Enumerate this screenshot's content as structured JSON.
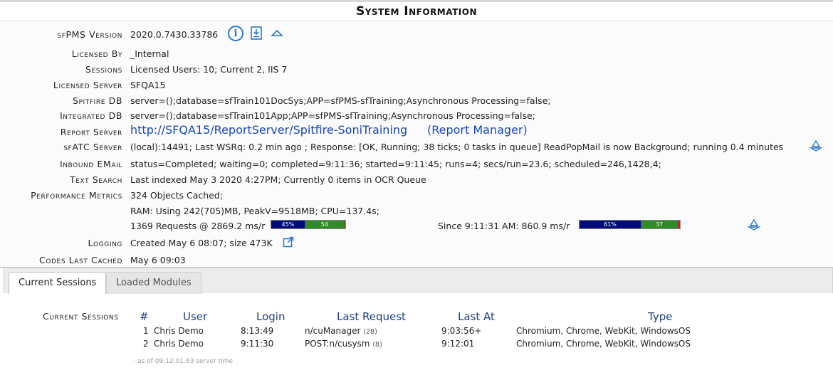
{
  "page_title": "System Information",
  "info": {
    "version_label": "sfPMS Version",
    "version_value": "2020.0.7430.33786",
    "licensed_by_label": "Licensed By",
    "licensed_by_value": "_Internal",
    "sessions_label": "Sessions",
    "sessions_value": "Licensed Users: 10; Current 2, IIS 7",
    "licensed_server_label": "Licensed Server",
    "licensed_server_value": "SFQA15",
    "spitfire_db_label": "Spitfire DB",
    "spitfire_db_value": "server=();database=sfTrain101DocSys;APP=sfPMS-sfTraining;Asynchronous Processing=false;",
    "integrated_db_label": "Integrated DB",
    "integrated_db_value": "server=();database=sfTrain101App;APP=sfPMS-sfTraining;Asynchronous Processing=false;",
    "report_server_label": "Report Server",
    "report_server_url": "http://SFQA15/ReportServer/Spitfire-SoniTraining",
    "report_manager_link": "(Report Manager)",
    "sfatc_label": "sfATC Server",
    "sfatc_value": "(local):14491; Last WSRq: 0.2 min ago ; Response: [OK, Running; 38 ticks; 0 tasks in queue] ReadPopMail is now Background; running 0.4 minutes",
    "inbound_email_label": "Inbound EMail",
    "inbound_email_value": "status=Completed; waiting=0; completed=9:11:36; started=9:11:45; runs=4; secs/run=23.6; scheduled=246,1428,4;",
    "text_search_label": "Text Search",
    "text_search_value": "Indexed May 3 2020 4:27PM; Currently 0 items in OCR Queue",
    "text_search_prefix": "Last indexed May 3 2020 4:27PM; Currently 0 items in OCR Queue",
    "perf_label": "Performance Metrics",
    "perf_cached": "324 Objects Cached;",
    "perf_ram": "RAM: Using 242(705)MB, PeakV=9518MB; CPU=137.4s;",
    "perf_requests": "1369 Requests @ 2869.2 ms/r",
    "perf_since": "Since 9:11:31 AM: 860.9 ms/r",
    "bar1": {
      "blue_pct": 45,
      "green_pct": 54,
      "blue_label": "45%",
      "green_label": "54"
    },
    "bar2": {
      "blue_pct": 61,
      "green_pct": 37,
      "blue_label": "61%",
      "green_label": "37"
    },
    "logging_label": "Logging",
    "logging_value": "Created May 6 08:07; size 473K",
    "codes_label": "Codes Last Cached",
    "codes_value": "May 6 09:03"
  },
  "tabs": [
    {
      "label": "Current Sessions",
      "active": true
    },
    {
      "label": "Loaded Modules",
      "active": false
    }
  ],
  "sessions": {
    "label": "Current Sessions",
    "headers": {
      "num": "#",
      "user": "User",
      "login": "Login",
      "last_request": "Last Request",
      "last_at": "Last At",
      "type": "Type"
    },
    "rows": [
      {
        "num": "1",
        "user": "Chris Demo",
        "login": "8:13:49",
        "request": "n/cuManager",
        "count": "(28)",
        "last_at": "9:03:56+",
        "type": "Chromium, Chrome, WebKit, WindowsOS"
      },
      {
        "num": "2",
        "user": "Chris Demo",
        "login": "9:11:30",
        "request": "POST:n/cusysm",
        "count": "(8)",
        "last_at": "9:12:01",
        "type": "Chromium, Chrome, WebKit, WindowsOS"
      }
    ],
    "as_of": "- as of 09:12:01.63 server time"
  },
  "colors": {
    "link": "#1a47b8",
    "bar_blue": "#000a7a",
    "bar_green": "#2e8b27",
    "bar_red": "#c0202a",
    "icon_blue": "#2a78c8"
  }
}
